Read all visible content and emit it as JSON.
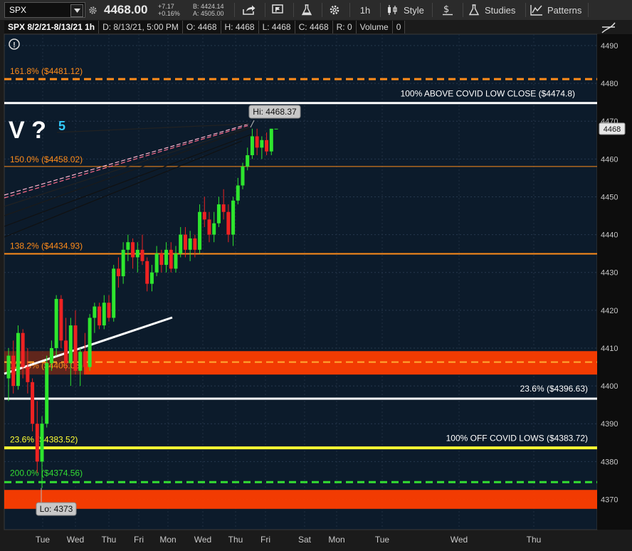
{
  "toolbar": {
    "symbol": "SPX",
    "last": "4468.00",
    "change": "+7.17",
    "change_pct": "+0.16%",
    "bid": "B: 4424.14",
    "ask": "A: 4505.00",
    "timeframe": "1h",
    "style_label": "Style",
    "studies_label": "Studies",
    "patterns_label": "Patterns"
  },
  "info": {
    "title": "SPX 8/2/21-8/13/21 1h",
    "date": "D: 8/13/21, 5:00 PM",
    "open": "O: 4468",
    "high": "H: 4468",
    "low": "L: 4468",
    "close": "C: 4468",
    "range": "R: 0",
    "volume_label": "Volume",
    "volume": "0"
  },
  "chart_data": {
    "type": "candlestick",
    "ylim": [
      4362,
      4493
    ],
    "y_ticks": [
      4370,
      4380,
      4390,
      4400,
      4410,
      4420,
      4430,
      4440,
      4450,
      4460,
      4470,
      4480,
      4490
    ],
    "x_labels": [
      "Tue",
      "Wed",
      "Thu",
      "Fri",
      "Mon",
      "Wed",
      "Thu",
      "Fri",
      "Sat",
      "Mon",
      "Tue",
      "Wed",
      "Thu"
    ],
    "last_price_label": "4468",
    "hi_label": "Hi: 4468.37",
    "lo_label": "Lo: 4373",
    "annotation": "V ?",
    "annotation_wave": "5",
    "levels": [
      {
        "label": "161.8%",
        "value_label": "($4481.12)",
        "value": 4481.12,
        "color": "#ff8c1a",
        "style": "dashed",
        "label_color": "#ff8c1a"
      },
      {
        "label": "100% ABOVE COVID LOW CLOSE ($4474.8)",
        "value": 4474.8,
        "color": "#ffffff",
        "style": "solid",
        "label_color": "#ffffff"
      },
      {
        "label": "150.0%",
        "value_label": "($4458.02)",
        "value": 4458.02,
        "color": "#ff8c1a",
        "style": "thin",
        "label_color": "#ff8c1a"
      },
      {
        "label": "138.2%",
        "value_label": "($4434.93)",
        "value": 4434.93,
        "color": "#ff8c1a",
        "style": "solid",
        "label_color": "#ff8c1a"
      },
      {
        "label": "123.6%",
        "value_label": "($4406.05)",
        "value": 4406.3,
        "color": "#ff8c1a",
        "style": "dashed",
        "label_color": "#ff8c1a"
      },
      {
        "label": "23.6%",
        "value_label": "($4396.63)",
        "value": 4396.63,
        "color": "#ffffff",
        "style": "solid",
        "label_color": "#ffffff"
      },
      {
        "label": "23.6%",
        "value_label": "($4383.52)",
        "value": 4383.52,
        "color": "#ffff33",
        "style": "solid",
        "label_color": "#ffff33"
      },
      {
        "label": "100% OFF COVID LOWS ($4383.72)",
        "value": 4383.72,
        "color": "#ffff33",
        "style": "solid",
        "label_color": "#ffffff"
      },
      {
        "label": "200.0%",
        "value_label": "($4374.56)",
        "value": 4374.56,
        "color": "#33dd33",
        "style": "dashed",
        "label_color": "#33dd33"
      }
    ],
    "zones": [
      {
        "from": 4403.0,
        "to": 4409.2,
        "color": "#ff3d00"
      },
      {
        "from": 4367.5,
        "to": 4372.5,
        "color": "#ff3d00"
      }
    ],
    "candles": [
      [
        4402,
        4410,
        4396,
        4408
      ],
      [
        4408,
        4412,
        4398,
        4400
      ],
      [
        4400,
        4416,
        4399,
        4414
      ],
      [
        4414,
        4415,
        4402,
        4405
      ],
      [
        4405,
        4410,
        4398,
        4401
      ],
      [
        4401,
        4402,
        4388,
        4390
      ],
      [
        4390,
        4396,
        4377,
        4380
      ],
      [
        4380,
        4392,
        4373,
        4390
      ],
      [
        4390,
        4408,
        4389,
        4406
      ],
      [
        4406,
        4412,
        4404,
        4410
      ],
      [
        4410,
        4424,
        4408,
        4423
      ],
      [
        4423,
        4424,
        4410,
        4412
      ],
      [
        4412,
        4418,
        4404,
        4406
      ],
      [
        4406,
        4418,
        4400,
        4416
      ],
      [
        4416,
        4420,
        4403,
        4404
      ],
      [
        4404,
        4410,
        4400,
        4409
      ],
      [
        4409,
        4414,
        4403,
        4405
      ],
      [
        4405,
        4419,
        4404,
        4418
      ],
      [
        4418,
        4422,
        4414,
        4421
      ],
      [
        4421,
        4422,
        4415,
        4416
      ],
      [
        4416,
        4424,
        4415,
        4422
      ],
      [
        4422,
        4424,
        4417,
        4418
      ],
      [
        4418,
        4432,
        4417,
        4431
      ],
      [
        4431,
        4434,
        4426,
        4429
      ],
      [
        4429,
        4438,
        4427,
        4436
      ],
      [
        4436,
        4440,
        4433,
        4438
      ],
      [
        4438,
        4439,
        4431,
        4434
      ],
      [
        4434,
        4438,
        4430,
        4436
      ],
      [
        4436,
        4440,
        4432,
        4433
      ],
      [
        4433,
        4434,
        4425,
        4427
      ],
      [
        4427,
        4432,
        4425,
        4430
      ],
      [
        4430,
        4437,
        4429,
        4435
      ],
      [
        4435,
        4436,
        4430,
        4432
      ],
      [
        4432,
        4438,
        4430,
        4436
      ],
      [
        4436,
        4438,
        4430,
        4431
      ],
      [
        4431,
        4437,
        4430,
        4435
      ],
      [
        4435,
        4442,
        4434,
        4440
      ],
      [
        4440,
        4442,
        4434,
        4436
      ],
      [
        4436,
        4441,
        4433,
        4439
      ],
      [
        4439,
        4440,
        4434,
        4436
      ],
      [
        4436,
        4448,
        4435,
        4446
      ],
      [
        4446,
        4450,
        4442,
        4444
      ],
      [
        4444,
        4446,
        4438,
        4440
      ],
      [
        4440,
        4446,
        4438,
        4443
      ],
      [
        4443,
        4450,
        4442,
        4448
      ],
      [
        4448,
        4452,
        4444,
        4446
      ],
      [
        4446,
        4448,
        4438,
        4440
      ],
      [
        4440,
        4450,
        4437,
        4449
      ],
      [
        4449,
        4455,
        4448,
        4453
      ],
      [
        4453,
        4459,
        4452,
        4458
      ],
      [
        4458,
        4463,
        4457,
        4461
      ],
      [
        4461,
        4468,
        4460,
        4466
      ],
      [
        4466,
        4468,
        4461,
        4463
      ],
      [
        4463,
        4466,
        4460,
        4465
      ],
      [
        4465,
        4467,
        4461,
        4462
      ],
      [
        4462,
        4468,
        4461,
        4468
      ],
      [
        4468,
        4468,
        4468,
        4468
      ]
    ]
  }
}
